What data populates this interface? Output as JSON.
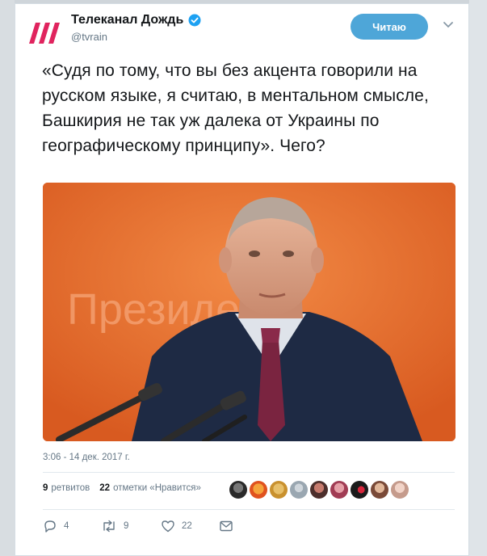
{
  "account": {
    "name": "Телеканал Дождь",
    "handle": "@tvrain",
    "logo_text": "///"
  },
  "follow_button_label": "Читаю",
  "tweet": {
    "text": "«Судя по тому, что вы без акцента говорили на русском языке, я считаю, в ментальном смысле, Башкирия не так уж далека от Украины по географическому принципу». Чего?",
    "photo_background_text": "Президе"
  },
  "timestamp": "3:06 - 14 дек. 2017 г.",
  "stats": {
    "retweets_count": "9",
    "retweets_label": "ретвитов",
    "likes_count": "22",
    "likes_label": "отметки «Нравится»"
  },
  "liker_avatar_count": 9,
  "actions": {
    "reply_count": "4",
    "retweet_count": "9",
    "like_count": "22"
  },
  "colors": {
    "accent": "#4ea6d8",
    "logo_red": "#e0245e",
    "verified_blue": "#1da1f2",
    "photo_orange": "#e8692c"
  },
  "icons": [
    "verified-badge-icon",
    "chevron-down-icon",
    "reply-icon",
    "retweet-icon",
    "like-icon",
    "direct-message-icon"
  ]
}
